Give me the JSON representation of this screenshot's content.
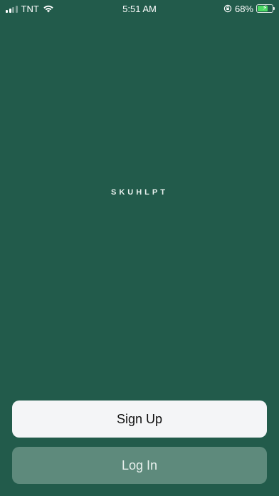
{
  "status_bar": {
    "carrier": "TNT",
    "time": "5:51 AM",
    "battery_percent": "68%",
    "battery_level": 0.68,
    "icons": [
      "signal-icon",
      "wifi-icon",
      "orientation-lock-icon",
      "battery-charging-icon"
    ]
  },
  "app": {
    "logo_text": "SKUHLPT"
  },
  "actions": {
    "signup_label": "Sign Up",
    "login_label": "Log In"
  },
  "colors": {
    "background": "#225b4b",
    "signup_button": "#f4f5f7",
    "login_button": "#5e8a7c"
  }
}
